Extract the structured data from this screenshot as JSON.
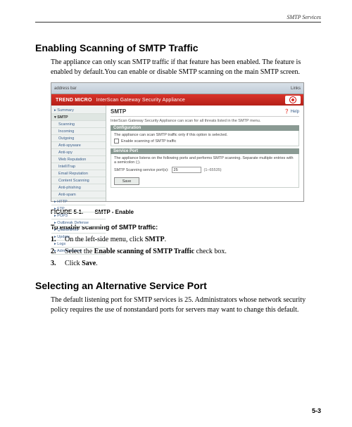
{
  "header": {
    "right": "SMTP Services"
  },
  "section1": {
    "title": "Enabling Scanning of SMTP Traffic",
    "para": "The appliance can only scan SMTP traffic if that feature has been enabled. The feature is enabled by default.You can enable or disable SMTP scanning on the main SMTP screen."
  },
  "screenshot": {
    "topbar_left": "address bar",
    "topbar_right": "Links",
    "brand_strong": "TREND MICRO",
    "brand_text": "InterScan Gateway Security Appliance",
    "sidebar": [
      "Summary",
      "SMTP",
      "Scanning",
      "Incoming",
      "Outgoing",
      "Anti-spyware",
      "Anti-spy",
      "Web Reputation",
      "IntelliTrap",
      "Email Reputation",
      "Content Scanning",
      "Anti-phishing",
      "Anti-spam",
      "HTTP",
      "FTP",
      "POP3",
      "Outbreak Defense",
      "Quarantines",
      "Update",
      "Logs",
      "Administration"
    ],
    "sidebar_selected_index": 1,
    "main_title": "SMTP",
    "help": "Help",
    "main_desc": "InterScan Gateway Security Appliance can scan for all threats listed in the SMTP menu.",
    "config_bar": "Configuration",
    "config_note": "The appliance can scan SMTP traffic only if this option is selected.",
    "checkbox_label": "Enable scanning of SMTP traffic",
    "serviceport_bar": "Service Port",
    "serviceport_note": "The appliance listens on the following ports and performs SMTP scanning. Separate multiple entries with a semicolon (;).",
    "port_label": "SMTP Scanning service port(s):",
    "port_value": "25",
    "port_hint": "(1–65535)",
    "save": "Save"
  },
  "figure": {
    "label": "FIGURE 5-1.",
    "desc": "SMTP - Enable"
  },
  "subhead": "To enable scanning of SMTP traffic:",
  "steps": {
    "s1_pre": "On the left-side menu, click ",
    "s1_b": "SMTP",
    "s1_post": ".",
    "s2_pre": "Select the ",
    "s2_b": "Enable scanning of SMTP Traffic",
    "s2_post": " check box.",
    "s3_pre": "Click ",
    "s3_b": "Save",
    "s3_post": "."
  },
  "section2": {
    "title": "Selecting an Alternative Service Port",
    "para": "The default listening port for SMTP services is 25. Administrators whose network security policy requires the use of nonstandard ports for servers may want to change this default."
  },
  "page_num": "5-3"
}
